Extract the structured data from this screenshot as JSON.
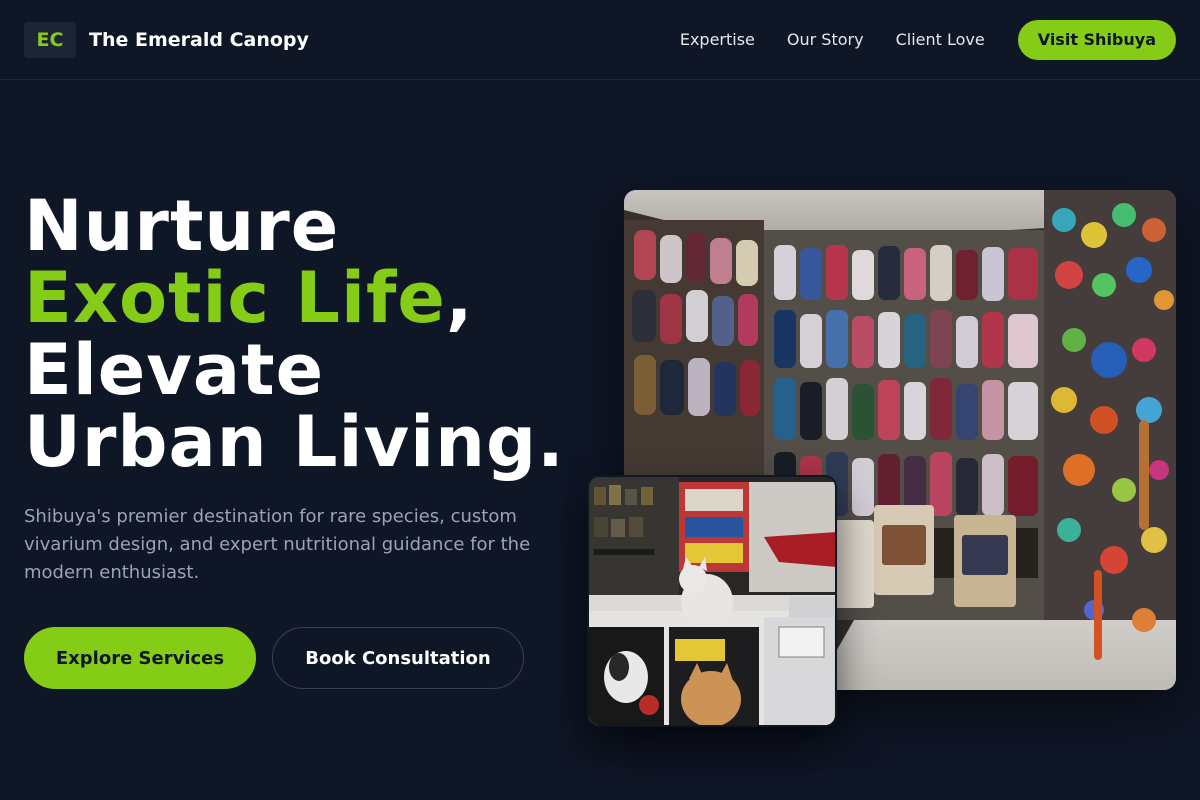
{
  "brand": {
    "logo_initials": "EC",
    "name": "The Emerald Canopy"
  },
  "nav": {
    "links": [
      "Expertise",
      "Our Story",
      "Client Love"
    ],
    "cta_label": "Visit Shibuya"
  },
  "hero": {
    "title_line1": "Nurture",
    "title_accent": "Exotic Life",
    "title_comma": ",",
    "title_line3": "Elevate",
    "title_line4": "Urban Living.",
    "subtitle": "Shibuya's premier destination for rare species, custom vivarium design, and expert nutritional guidance for the modern enthusiast.",
    "primary_button": "Explore Services",
    "secondary_button": "Book Consultation"
  },
  "images": {
    "large": "pet-store-wall-photo",
    "small": "pet-store-cat-counter-photo"
  },
  "colors": {
    "background": "#0f1626",
    "accent": "#84cc16",
    "text": "#ffffff",
    "muted_text": "#9ca3b4"
  }
}
